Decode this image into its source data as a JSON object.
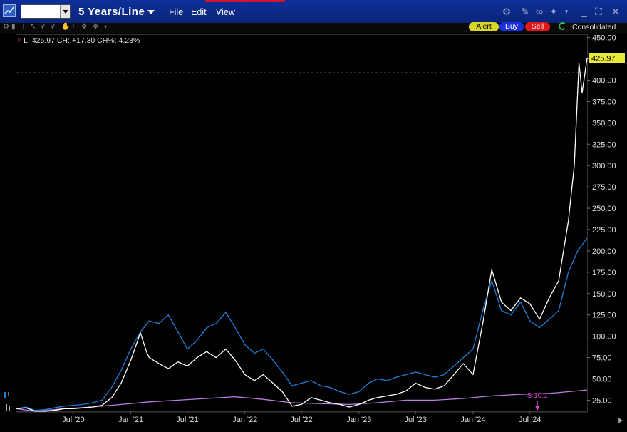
{
  "window": {
    "symbol_value": "",
    "period_label": "5 Years/Line",
    "menu": [
      "File",
      "Edit",
      "View"
    ]
  },
  "toolbar": {
    "alert_label": "Alert",
    "buy_label": "Buy",
    "sell_label": "Sell",
    "exchange_label": "Consolidated"
  },
  "legend": {
    "text": "L: 425.97 CH: +17.30 CH%: 4.23%"
  },
  "last_price_badge": "425.97",
  "split_annotation": "S 10:1",
  "colors": {
    "main_series": "#ffffff",
    "compare_series_1": "#1f7ed8",
    "compare_series_2": "#b97fe0",
    "split_marker": "#e03bd6",
    "badge": "#e8e83a",
    "titlebar": "#0c2f9a"
  },
  "chart_data": {
    "type": "line",
    "x_ticks": [
      "Jul '20",
      "Jan '21",
      "Jul '21",
      "Jan '22",
      "Jul '22",
      "Jan '23",
      "Jul '23",
      "Jan '24",
      "Jul '24"
    ],
    "y_ticks": [
      "25.00",
      "50.00",
      "75.00",
      "100.00",
      "125.00",
      "150.00",
      "175.00",
      "200.00",
      "225.00",
      "250.00",
      "275.00",
      "300.00",
      "325.00",
      "350.00",
      "375.00",
      "400.00",
      "425.00",
      "450.00"
    ],
    "ylim": [
      12,
      453
    ],
    "x_range": [
      "2020-01",
      "2024-12"
    ],
    "grid": false,
    "series": [
      {
        "color": "#ffffff",
        "points": [
          [
            "2020-01",
            15
          ],
          [
            "2020-02",
            16
          ],
          [
            "2020-03",
            12
          ],
          [
            "2020-04",
            12
          ],
          [
            "2020-05",
            13
          ],
          [
            "2020-06",
            15
          ],
          [
            "2020-07",
            15
          ],
          [
            "2020-08",
            16
          ],
          [
            "2020-09",
            17
          ],
          [
            "2020-10",
            19
          ],
          [
            "2020-11",
            28
          ],
          [
            "2020-12",
            45
          ],
          [
            "2021-01",
            72
          ],
          [
            "2021-02",
            104
          ],
          [
            "2021-02-20",
            82
          ],
          [
            "2021-03",
            75
          ],
          [
            "2021-04",
            68
          ],
          [
            "2021-05",
            62
          ],
          [
            "2021-06",
            70
          ],
          [
            "2021-07",
            65
          ],
          [
            "2021-08",
            75
          ],
          [
            "2021-09",
            82
          ],
          [
            "2021-10",
            75
          ],
          [
            "2021-11",
            85
          ],
          [
            "2021-12",
            72
          ],
          [
            "2022-01",
            55
          ],
          [
            "2022-02",
            48
          ],
          [
            "2022-03",
            55
          ],
          [
            "2022-04",
            45
          ],
          [
            "2022-05",
            35
          ],
          [
            "2022-06",
            18
          ],
          [
            "2022-07",
            20
          ],
          [
            "2022-08",
            28
          ],
          [
            "2022-09",
            25
          ],
          [
            "2022-10",
            22
          ],
          [
            "2022-11",
            20
          ],
          [
            "2022-12",
            17
          ],
          [
            "2023-01",
            20
          ],
          [
            "2023-02",
            25
          ],
          [
            "2023-03",
            28
          ],
          [
            "2023-04",
            30
          ],
          [
            "2023-05",
            32
          ],
          [
            "2023-06",
            36
          ],
          [
            "2023-07",
            45
          ],
          [
            "2023-08",
            40
          ],
          [
            "2023-09",
            38
          ],
          [
            "2023-10",
            42
          ],
          [
            "2023-11",
            55
          ],
          [
            "2023-12",
            68
          ],
          [
            "2024-01",
            55
          ],
          [
            "2024-02",
            115
          ],
          [
            "2024-03",
            178
          ],
          [
            "2024-04",
            140
          ],
          [
            "2024-05",
            130
          ],
          [
            "2024-06",
            145
          ],
          [
            "2024-07",
            138
          ],
          [
            "2024-08",
            120
          ],
          [
            "2024-09",
            145
          ],
          [
            "2024-10",
            165
          ],
          [
            "2024-11",
            235
          ],
          [
            "2024-11-20",
            300
          ],
          [
            "2024-12-05",
            420
          ],
          [
            "2024-12-15",
            385
          ],
          [
            "2024-12-31",
            425.97
          ]
        ]
      },
      {
        "color": "#1f7ed8",
        "points": [
          [
            "2020-01",
            15
          ],
          [
            "2020-02",
            17
          ],
          [
            "2020-03",
            13
          ],
          [
            "2020-04",
            14
          ],
          [
            "2020-05",
            16
          ],
          [
            "2020-06",
            18
          ],
          [
            "2020-07",
            19
          ],
          [
            "2020-08",
            20
          ],
          [
            "2020-09",
            22
          ],
          [
            "2020-10",
            25
          ],
          [
            "2020-11",
            40
          ],
          [
            "2020-12",
            60
          ],
          [
            "2021-01",
            85
          ],
          [
            "2021-02",
            105
          ],
          [
            "2021-03",
            118
          ],
          [
            "2021-04",
            115
          ],
          [
            "2021-05",
            125
          ],
          [
            "2021-06",
            105
          ],
          [
            "2021-07",
            85
          ],
          [
            "2021-08",
            95
          ],
          [
            "2021-09",
            110
          ],
          [
            "2021-10",
            115
          ],
          [
            "2021-11",
            128
          ],
          [
            "2021-12",
            110
          ],
          [
            "2022-01",
            90
          ],
          [
            "2022-02",
            80
          ],
          [
            "2022-03",
            85
          ],
          [
            "2022-04",
            72
          ],
          [
            "2022-05",
            58
          ],
          [
            "2022-06",
            42
          ],
          [
            "2022-07",
            45
          ],
          [
            "2022-08",
            48
          ],
          [
            "2022-09",
            42
          ],
          [
            "2022-10",
            40
          ],
          [
            "2022-11",
            35
          ],
          [
            "2022-12",
            32
          ],
          [
            "2023-01",
            35
          ],
          [
            "2023-02",
            45
          ],
          [
            "2023-03",
            50
          ],
          [
            "2023-04",
            48
          ],
          [
            "2023-05",
            52
          ],
          [
            "2023-06",
            55
          ],
          [
            "2023-07",
            58
          ],
          [
            "2023-08",
            55
          ],
          [
            "2023-09",
            52
          ],
          [
            "2023-10",
            55
          ],
          [
            "2023-11",
            65
          ],
          [
            "2023-12",
            75
          ],
          [
            "2024-01",
            85
          ],
          [
            "2024-02",
            130
          ],
          [
            "2024-03",
            165
          ],
          [
            "2024-04",
            130
          ],
          [
            "2024-05",
            125
          ],
          [
            "2024-06",
            140
          ],
          [
            "2024-07",
            118
          ],
          [
            "2024-08",
            110
          ],
          [
            "2024-09",
            120
          ],
          [
            "2024-10",
            130
          ],
          [
            "2024-11",
            175
          ],
          [
            "2024-12",
            200
          ],
          [
            "2024-12-31",
            215
          ]
        ]
      },
      {
        "color": "#b97fe0",
        "points": [
          [
            "2020-01",
            15
          ],
          [
            "2020-03",
            12
          ],
          [
            "2020-06",
            15
          ],
          [
            "2020-09",
            17
          ],
          [
            "2020-12",
            20
          ],
          [
            "2021-03",
            23
          ],
          [
            "2021-06",
            25
          ],
          [
            "2021-09",
            27
          ],
          [
            "2021-12",
            29
          ],
          [
            "2022-03",
            26
          ],
          [
            "2022-06",
            22
          ],
          [
            "2022-09",
            21
          ],
          [
            "2022-12",
            20
          ],
          [
            "2023-03",
            22
          ],
          [
            "2023-06",
            25
          ],
          [
            "2023-09",
            25
          ],
          [
            "2023-12",
            27
          ],
          [
            "2024-03",
            30
          ],
          [
            "2024-06",
            32
          ],
          [
            "2024-09",
            33
          ],
          [
            "2024-12-31",
            37
          ]
        ]
      }
    ]
  }
}
